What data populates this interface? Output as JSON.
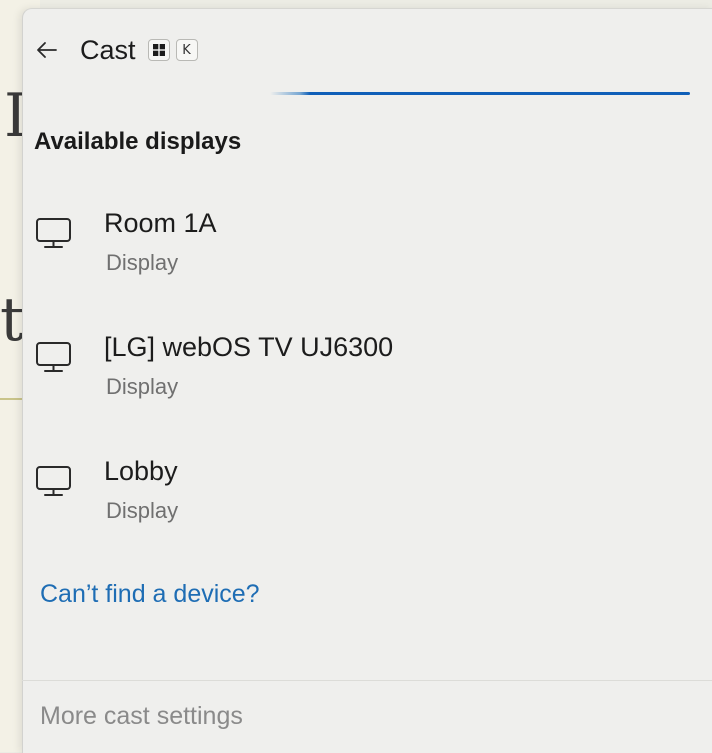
{
  "background": {
    "glyphs": [
      "I",
      "t"
    ]
  },
  "header": {
    "back_icon": "arrow-left-icon",
    "title": "Cast",
    "shortcut_keys": [
      "windows-key",
      "K"
    ]
  },
  "progress": {
    "state": "indeterminate",
    "color": "#0f5fb8"
  },
  "section": {
    "title": "Available displays"
  },
  "devices": [
    {
      "name": "Room 1A",
      "type": "Display",
      "icon": "monitor-icon"
    },
    {
      "name": "[LG] webOS TV UJ6300",
      "type": "Display",
      "icon": "monitor-icon"
    },
    {
      "name": "Lobby",
      "type": "Display",
      "icon": "monitor-icon"
    }
  ],
  "links": {
    "cant_find": "Can’t find a device?",
    "more_settings": "More cast settings"
  },
  "colors": {
    "accent": "#1e6db4",
    "panel_bg": "#efefed"
  }
}
